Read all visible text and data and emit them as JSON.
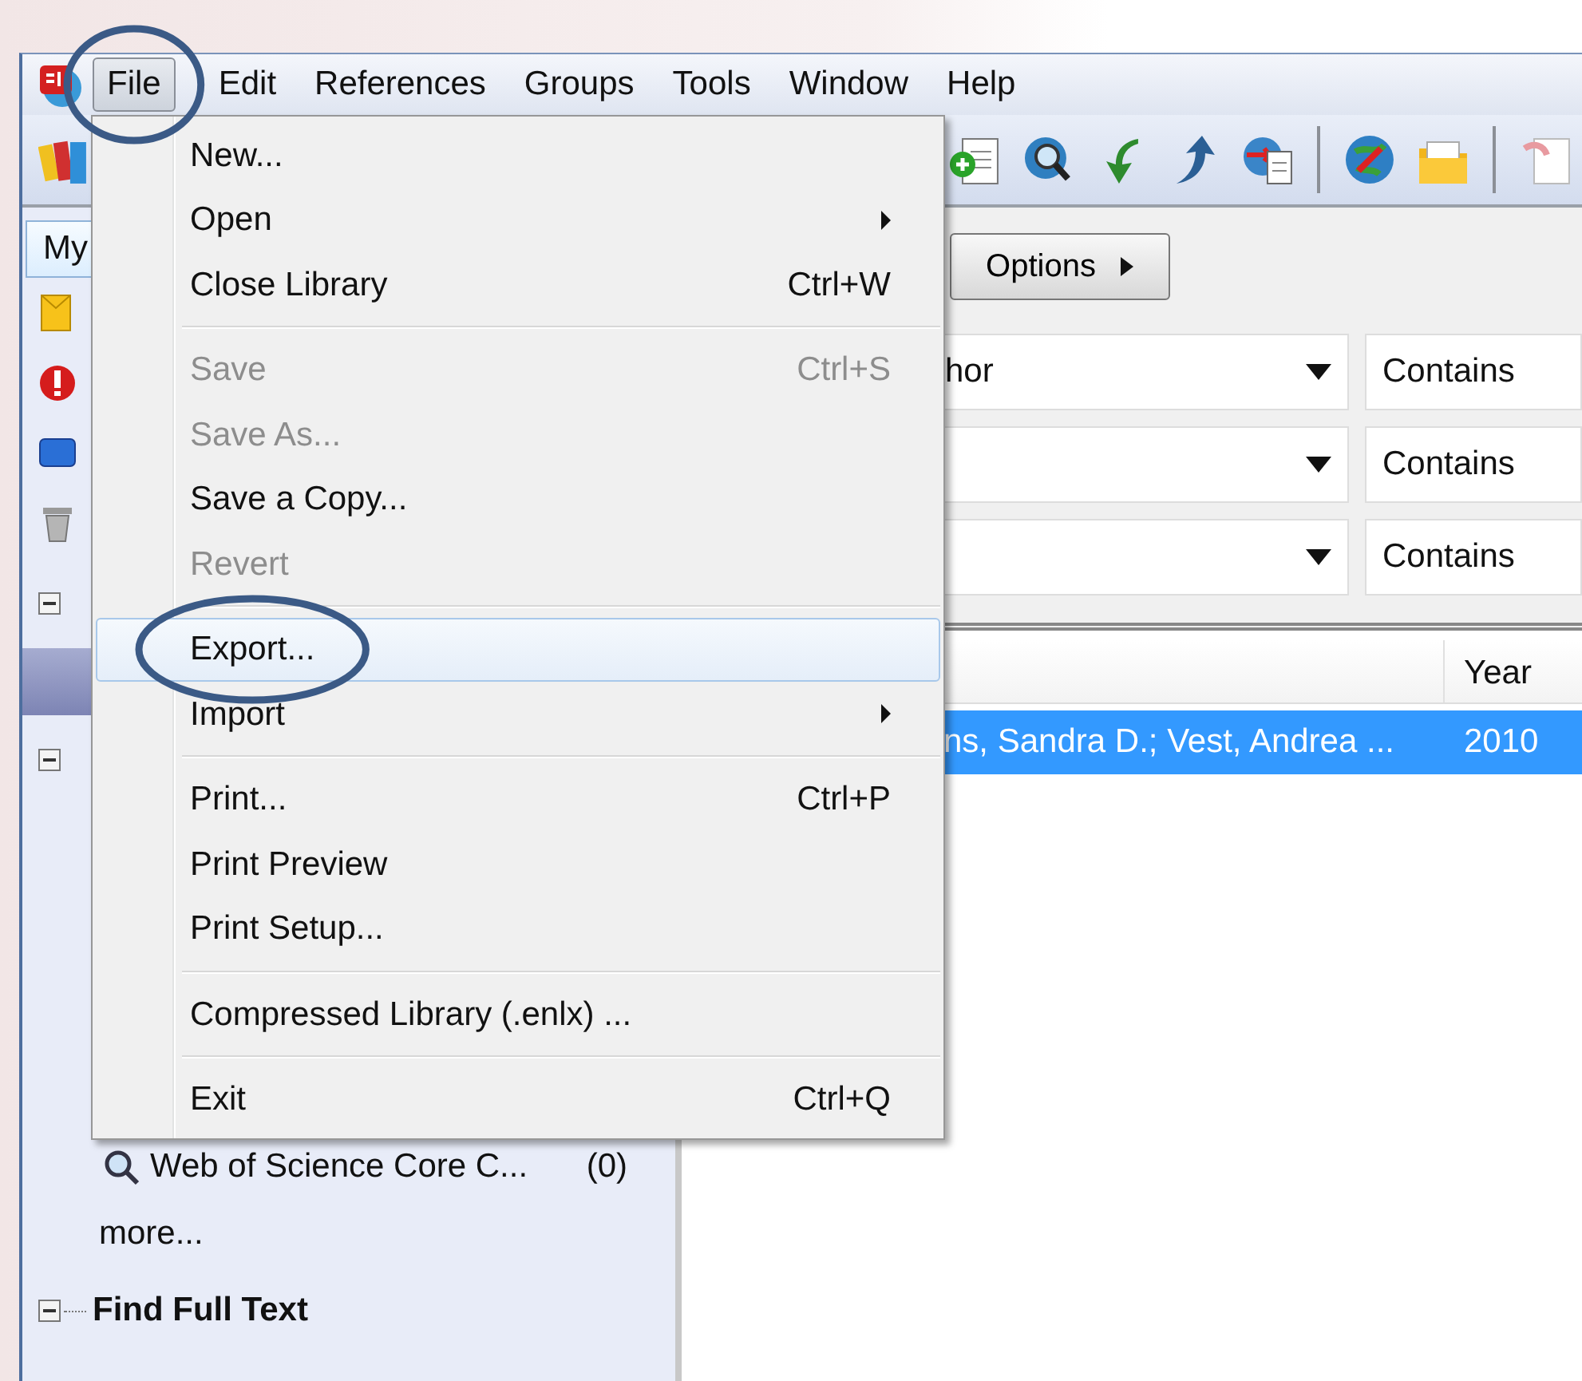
{
  "menubar": {
    "items": [
      {
        "label": "File",
        "selected": true,
        "circled": true
      },
      {
        "label": "Edit",
        "selected": false,
        "circled": false
      },
      {
        "label": "References",
        "selected": false,
        "circled": false
      },
      {
        "label": "Groups",
        "selected": false,
        "circled": false
      },
      {
        "label": "Tools",
        "selected": false,
        "circled": false
      },
      {
        "label": "Window",
        "selected": false,
        "circled": false
      },
      {
        "label": "Help",
        "selected": false,
        "circled": false
      }
    ]
  },
  "file_menu": {
    "items": [
      {
        "kind": "item",
        "label": "New...",
        "disabled": false,
        "selected": false,
        "circled": false
      },
      {
        "kind": "submenu",
        "label": "Open",
        "disabled": false,
        "selected": false,
        "circled": false
      },
      {
        "kind": "item",
        "label": "Close Library",
        "shortcut": "Ctrl+W",
        "disabled": false,
        "selected": false,
        "circled": false
      },
      {
        "kind": "separator"
      },
      {
        "kind": "item",
        "label": "Save",
        "shortcut": "Ctrl+S",
        "disabled": true,
        "selected": false,
        "circled": false
      },
      {
        "kind": "item",
        "label": "Save As...",
        "disabled": true,
        "selected": false,
        "circled": false
      },
      {
        "kind": "item",
        "label": "Save a Copy...",
        "disabled": false,
        "selected": false,
        "circled": false
      },
      {
        "kind": "item",
        "label": "Revert",
        "disabled": true,
        "selected": false,
        "circled": false
      },
      {
        "kind": "separator"
      },
      {
        "kind": "item",
        "label": "Export...",
        "disabled": false,
        "selected": true,
        "circled": true
      },
      {
        "kind": "submenu",
        "label": "Import",
        "disabled": false,
        "selected": false,
        "circled": false
      },
      {
        "kind": "separator"
      },
      {
        "kind": "item",
        "label": "Print...",
        "shortcut": "Ctrl+P",
        "disabled": false,
        "selected": false,
        "circled": false
      },
      {
        "kind": "item",
        "label": "Print Preview",
        "disabled": false,
        "selected": false,
        "circled": false
      },
      {
        "kind": "item",
        "label": "Print Setup...",
        "disabled": false,
        "selected": false,
        "circled": false
      },
      {
        "kind": "separator"
      },
      {
        "kind": "item",
        "label": "Compressed Library (.enlx) ...",
        "disabled": false,
        "selected": false,
        "circled": false
      },
      {
        "kind": "separator"
      },
      {
        "kind": "item",
        "label": "Exit",
        "shortcut": "Ctrl+Q",
        "disabled": false,
        "selected": false,
        "circled": false
      }
    ]
  },
  "sidebar": {
    "tab": "My",
    "items": [
      {
        "kind": "envelope"
      },
      {
        "kind": "alert"
      },
      {
        "kind": "folder"
      },
      {
        "kind": "trash"
      }
    ],
    "groups": [
      {
        "expanded": true,
        "children": [
          {
            "selected": true
          }
        ]
      },
      {
        "expanded": true
      }
    ],
    "online_search": [
      {
        "label": "Web of Science Core C...",
        "count": "(0)"
      }
    ],
    "more": "more...",
    "find_full_text": {
      "label": "Find Full Text",
      "expanded": true
    }
  },
  "search": {
    "options_button": "Options",
    "rows": [
      {
        "field": "hor",
        "operator": "Contains"
      },
      {
        "operator": "Contains"
      },
      {
        "operator": "Contains"
      }
    ]
  },
  "table": {
    "columns": [
      {},
      {
        "label": "Year"
      }
    ],
    "rows": [
      {
        "selected": true,
        "cells": [
          "ns, Sandra D.; Vest, Andrea ...",
          "2010"
        ]
      }
    ]
  }
}
